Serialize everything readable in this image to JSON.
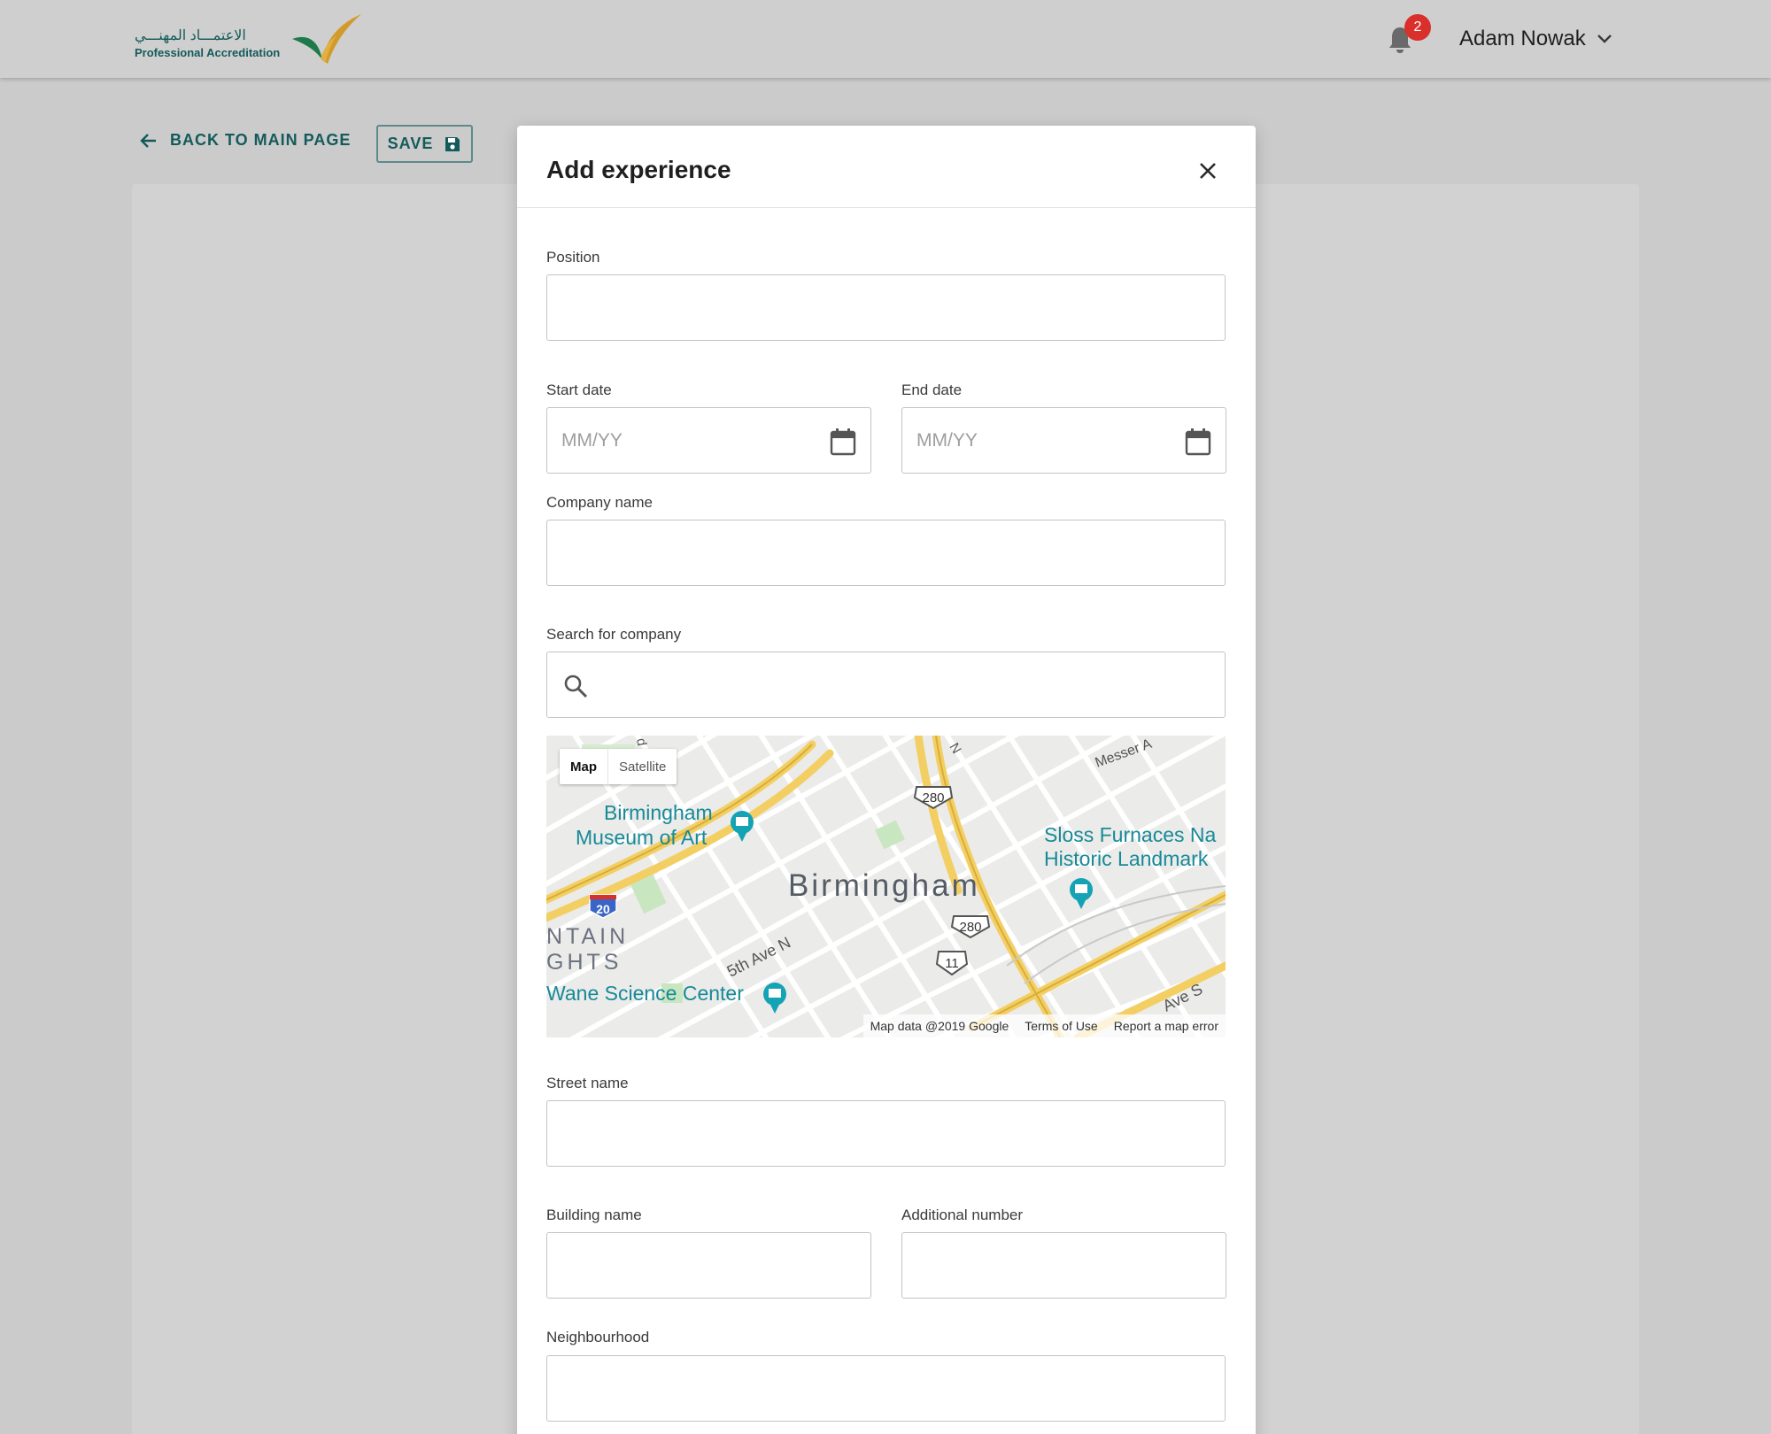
{
  "header": {
    "logo_arabic": "الاعتمـــاد المهنـــي",
    "logo_english": "Professional Accreditation",
    "notification_count": "2",
    "user_name": "Adam Nowak"
  },
  "toolbar": {
    "back_label": "BACK TO MAIN PAGE",
    "save_label": "SAVE"
  },
  "modal": {
    "title": "Add experience",
    "fields": {
      "position": {
        "label": "Position",
        "value": "",
        "placeholder": ""
      },
      "start_date": {
        "label": "Start date",
        "placeholder": "MM/YY"
      },
      "end_date": {
        "label": "End date",
        "placeholder": "MM/YY"
      },
      "company_name": {
        "label": "Company name",
        "value": ""
      },
      "search_company": {
        "label": "Search for company",
        "value": ""
      },
      "street_name": {
        "label": "Street name",
        "value": ""
      },
      "building_name": {
        "label": "Building name",
        "value": ""
      },
      "additional_number": {
        "label": "Additional number",
        "value": ""
      },
      "neighbourhood": {
        "label": "Neighbourhood",
        "value": ""
      }
    },
    "map": {
      "toggle_map": "Map",
      "toggle_satellite": "Satellite",
      "city_label": "Birmingham",
      "poi_museum_line1": "Birmingham",
      "poi_museum_line2": "Museum of Art",
      "poi_furnaces_line1": "Sloss Furnaces Na",
      "poi_furnaces_line2": "Historic Landmark",
      "poi_science": "Wane Science Center",
      "district_line1": "NTAIN",
      "district_line2": "GHTS",
      "street_5th": "5th Ave N",
      "street_messer": "Messer A",
      "street_ave_s": "Ave S",
      "street_n": "N",
      "street_d": "d",
      "shield_280a": "280",
      "shield_280b": "280",
      "shield_11": "11",
      "shield_20": "20",
      "footer_data": "Map data @2019 Google",
      "footer_terms": "Terms of Use",
      "footer_report": "Report a map error"
    }
  },
  "colors": {
    "brand_teal": "#145a5a",
    "badge_red": "#d9302c",
    "overlay": "#cbcbcb"
  }
}
